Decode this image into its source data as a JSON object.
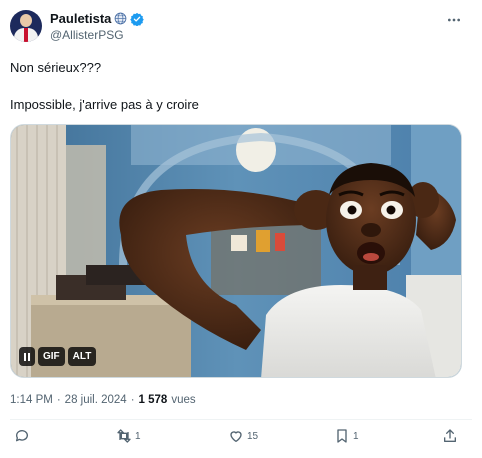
{
  "author": {
    "display_name": "Pauletista",
    "handle": "@AllisterPSG",
    "avatar_icon": "avatar-psg-player",
    "badges": [
      "globe-icon",
      "verified-icon"
    ],
    "verified_color": "#1d9bf0"
  },
  "tweet": {
    "line1": "Non sérieux???",
    "line2": "Impossible, j'arrive pas à y croire"
  },
  "media": {
    "type": "gif",
    "pause_icon": "pause-icon",
    "gif_label": "GIF",
    "alt_label": "ALT"
  },
  "meta": {
    "time": "1:14 PM",
    "separator": "·",
    "date": "28 juil. 2024",
    "separator2": "·",
    "views_count": "1 578",
    "views_label": "vues"
  },
  "actions": {
    "replies": "",
    "retweets": "1",
    "likes": "15",
    "bookmarks": "1"
  },
  "colors": {
    "text": "#0f1419",
    "secondary": "#536471",
    "accent": "#1d9bf0"
  }
}
